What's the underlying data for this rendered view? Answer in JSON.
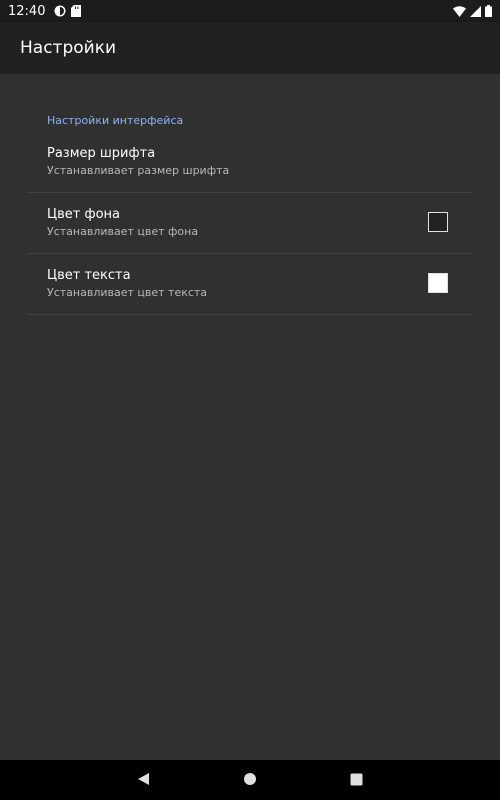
{
  "status_bar": {
    "time": "12:40",
    "icons": [
      "data-saver-icon",
      "sd-card-icon",
      "wifi-icon",
      "cell-signal-icon",
      "battery-icon"
    ]
  },
  "app_bar": {
    "title": "Настройки"
  },
  "settings": {
    "category": "Настройки интерфейса",
    "category_color": "#8ab4f8",
    "items": [
      {
        "title": "Размер шрифта",
        "summary": "Устанавливает размер шрифта"
      },
      {
        "title": "Цвет фона",
        "summary": "Устанавливает цвет фона",
        "swatch_color": "#222222"
      },
      {
        "title": "Цвет текста",
        "summary": "Устанавливает цвет текста",
        "swatch_color": "#ffffff"
      }
    ]
  },
  "nav_bar": {
    "buttons": [
      "back-icon",
      "home-icon",
      "recents-icon"
    ]
  }
}
